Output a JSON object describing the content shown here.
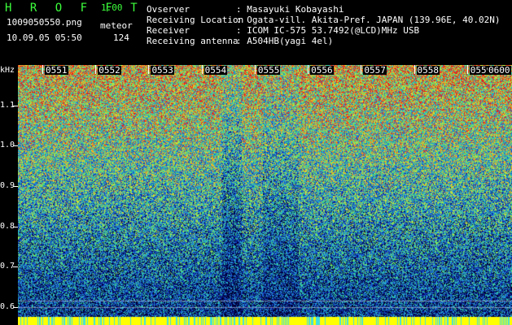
{
  "app": {
    "name": "H R O F F T",
    "version": "1.00"
  },
  "file": {
    "name": "1009050550.png",
    "datetime": "10.09.05 05:50"
  },
  "meteor": {
    "label": "meteor",
    "count": "124"
  },
  "info": [
    {
      "label": "Ovserver",
      "value": ": Masayuki Kobayashi"
    },
    {
      "label": "Receiving Location",
      "value": ": Ogata-vill. Akita-Pref. JAPAN (139.96E, 40.02N)"
    },
    {
      "label": "Receiver",
      "value": ": ICOM IC-575 53.7492(@LCD)MHz USB"
    },
    {
      "label": "Receiving antenna",
      "value": ": A504HB(yagi 4el)"
    }
  ],
  "spectrogram": {
    "unit": "kHz",
    "freq_labels": [
      "1.1",
      "1.0",
      "0.9",
      "0.8",
      "0.7",
      "0.6"
    ],
    "freq_values": [
      1.1,
      1.0,
      0.9,
      0.8,
      0.7,
      0.6
    ],
    "freq_range": [
      0.58,
      1.2
    ],
    "time_labels": [
      "0551",
      "0552",
      "0553",
      "0554",
      "0555",
      "0556",
      "0557",
      "0558",
      "0559",
      "0600"
    ],
    "palette": [
      "#000033",
      "#0a1a8c",
      "#1446c8",
      "#1e78dc",
      "#28b4c8",
      "#3cd28c",
      "#8ce650",
      "#dcdc32",
      "#f08c1e",
      "#e61e1e"
    ],
    "baseline_color": "#ffff00"
  }
}
